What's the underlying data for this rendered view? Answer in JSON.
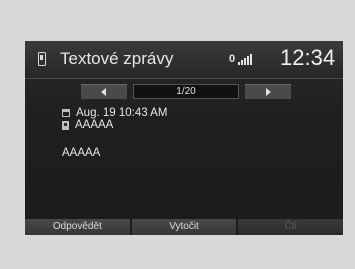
{
  "header": {
    "title": "Textové zprávy",
    "message_indicator": "0",
    "clock": "12:34"
  },
  "pager": {
    "counter": "1/20"
  },
  "message": {
    "date": "Aug. 19 10:43 AM",
    "sender": "AAAAA",
    "body": "AAAAA"
  },
  "footer": {
    "reply_label": "Odpovědět",
    "call_label": "Vytočit",
    "third_label": "Čti"
  }
}
